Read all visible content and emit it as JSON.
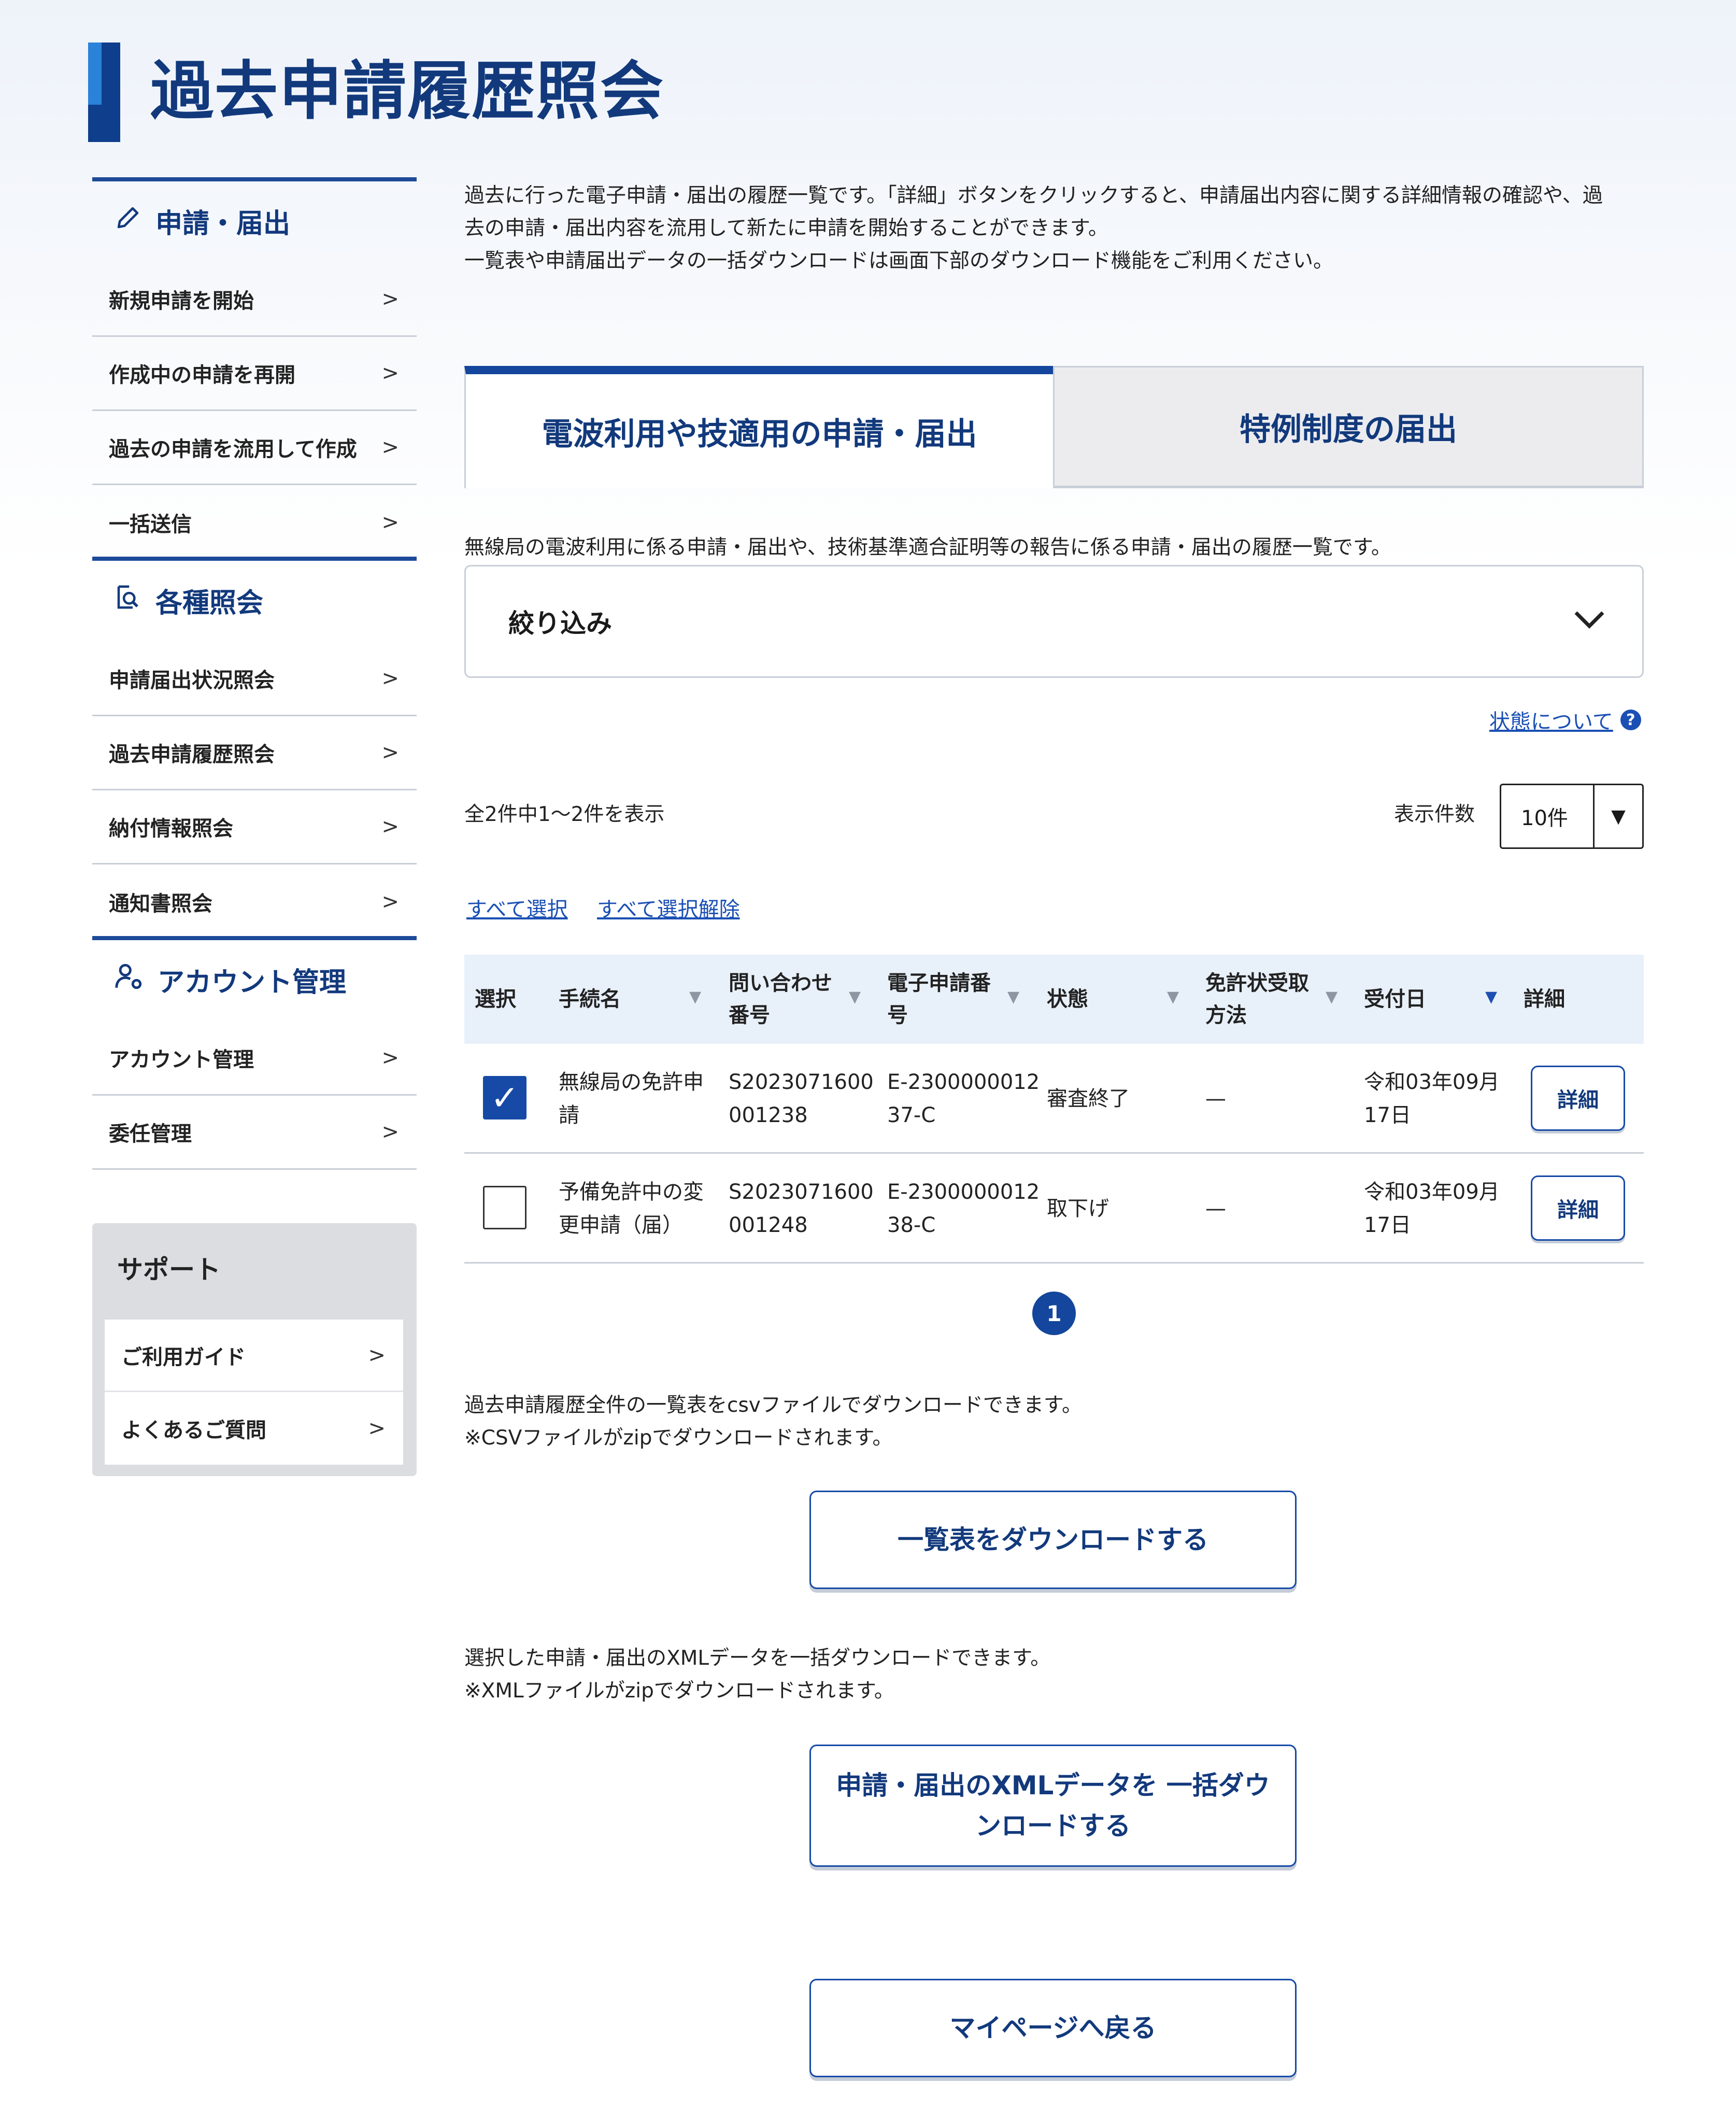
{
  "page": {
    "title": "過去申請履歴照会"
  },
  "sidebar": {
    "sections": [
      {
        "title": "申請・届出",
        "icon": "pencil-icon",
        "items": [
          "新規申請を開始",
          "作成中の申請を再開",
          "過去の申請を流用して作成",
          "一括送信"
        ]
      },
      {
        "title": "各種照会",
        "icon": "document-search-icon",
        "items": [
          "申請届出状況照会",
          "過去申請履歴照会",
          "納付情報照会",
          "通知書照会"
        ]
      },
      {
        "title": "アカウント管理",
        "icon": "user-gear-icon",
        "items": [
          "アカウント管理",
          "委任管理"
        ]
      }
    ],
    "support": {
      "title": "サポート",
      "items": [
        "ご利用ガイド",
        "よくあるご質問"
      ]
    }
  },
  "main": {
    "intro": [
      "過去に行った電子申請・届出の履歴一覧です。「詳細」ボタンをクリックすると、申請届出内容に関する詳細情報の確認や、過",
      "去の申請・届出内容を流用して新たに申請を開始することができます。",
      "一覧表や申請届出データの一括ダウンロードは画面下部のダウンロード機能をご利用ください。"
    ],
    "tabs": [
      {
        "label": "電波利用や技適用の申請・届出",
        "active": true
      },
      {
        "label": "特例制度の届出",
        "active": false
      }
    ],
    "tab_description": "無線局の電波利用に係る申請・届出や、技術基準適合証明等の報告に係る申請・届出の履歴一覧です。",
    "filter": {
      "label": "絞り込み"
    },
    "status_help": "状態について",
    "result_count": "全2件中1〜2件を表示",
    "page_size": {
      "label": "表示件数",
      "value": "10件"
    },
    "select_all": "すべて選択",
    "deselect_all": "すべて選択解除",
    "table": {
      "headers": {
        "select": "選択",
        "procedure": "手続名",
        "inquiry_1": "問い合わせ",
        "inquiry_2": "番号",
        "app_no_1": "電子申請番",
        "app_no_2": "号",
        "status": "状態",
        "license_1": "免許状受取",
        "license_2": "方法",
        "date": "受付日",
        "detail": "詳細"
      },
      "rows": [
        {
          "checked": true,
          "procedure_1": "無線局の免許申",
          "procedure_2": "請",
          "inquiry_1": "S2023071600",
          "inquiry_2": "001238",
          "app_no_1": "E-2300000012",
          "app_no_2": "37-C",
          "status": "審査終了",
          "license": "—",
          "date_1": "令和03年09月",
          "date_2": "17日",
          "detail": "詳細"
        },
        {
          "checked": false,
          "procedure_1": "予備免許中の変",
          "procedure_2": "更申請（届）",
          "inquiry_1": "S2023071600",
          "inquiry_2": "001248",
          "app_no_1": "E-2300000012",
          "app_no_2": "38-C",
          "status": "取下げ",
          "license": "—",
          "date_1": "令和03年09月",
          "date_2": "17日",
          "detail": "詳細"
        }
      ]
    },
    "pagination": {
      "current": "1"
    },
    "csv_note_1": "過去申請履歴全件の一覧表をcsvファイルでダウンロードできます。",
    "csv_note_2": "※CSVファイルがzipでダウンロードされます。",
    "csv_button": "一覧表をダウンロードする",
    "xml_note_1": "選択した申請・届出のXMLデータを一括ダウンロードできます。",
    "xml_note_2": "※XMLファイルがzipでダウンロードされます。",
    "xml_button_1": "申請・届出のXMLデータを 一括ダウ",
    "xml_button_2": "ンロードする",
    "back_button": "マイページへ戻る"
  },
  "colors": {
    "brand": "#12397c",
    "accent": "#13469c",
    "link": "#1a4fb4",
    "header_bg": "#e8f0fa"
  }
}
